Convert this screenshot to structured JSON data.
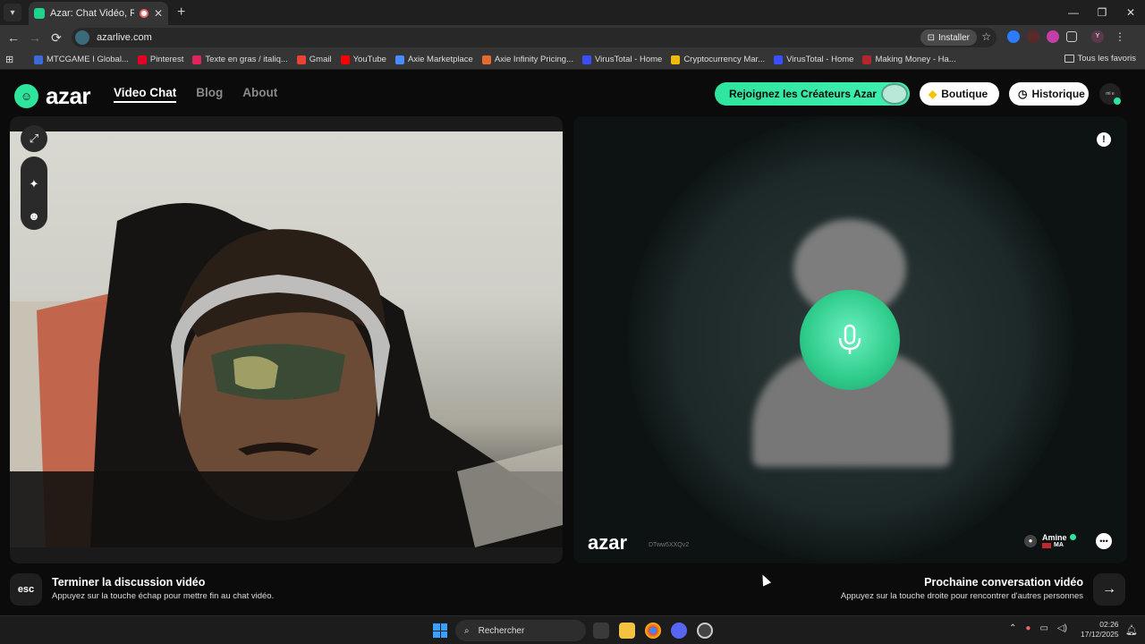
{
  "browser": {
    "tab_title": "Azar: Chat Vidéo, Rencontre",
    "url": "azarlive.com",
    "install_label": "Installer",
    "bookmarks": [
      {
        "label": "MTCGAME I Global...",
        "color": "#3a6bd6"
      },
      {
        "label": "Pinterest",
        "color": "#e60023"
      },
      {
        "label": "Texte en gras / italiq...",
        "color": "#e0245e"
      },
      {
        "label": "Gmail",
        "color": "#ea4335"
      },
      {
        "label": "YouTube",
        "color": "#ff0000"
      },
      {
        "label": "Axie Marketplace",
        "color": "#4a8cff"
      },
      {
        "label": "Axie Infinity Pricing...",
        "color": "#e36b2c"
      },
      {
        "label": "VirusTotal - Home",
        "color": "#394eff"
      },
      {
        "label": "Cryptocurrency Mar...",
        "color": "#f0b90b"
      },
      {
        "label": "VirusTotal - Home",
        "color": "#394eff"
      },
      {
        "label": "Making Money - Ha...",
        "color": "#b3262d"
      }
    ],
    "all_bookmarks": "Tous les favoris"
  },
  "site": {
    "logo": "azar",
    "nav": [
      "Video Chat",
      "Blog",
      "About"
    ],
    "creators_button": "Rejoignez les Créateurs Azar",
    "shop_button": "Boutique",
    "history_button": "Historique",
    "avatar_text": "ml e",
    "accent": "#2ee59d"
  },
  "remote": {
    "watermark": "azar",
    "session_id": "DTww5XXQv2",
    "user_name": "Amine",
    "country": "MA"
  },
  "actions": {
    "esc_key": "esc",
    "end_title": "Terminer la discussion vidéo",
    "end_sub": "Appuyez sur la touche échap pour mettre fin au chat vidéo.",
    "next_title": "Prochaine conversation vidéo",
    "next_sub": "Appuyez sur la touche droite pour rencontrer d'autres personnes"
  },
  "taskbar": {
    "search_placeholder": "Rechercher",
    "time": "02:26",
    "date": "17/12/2025"
  }
}
